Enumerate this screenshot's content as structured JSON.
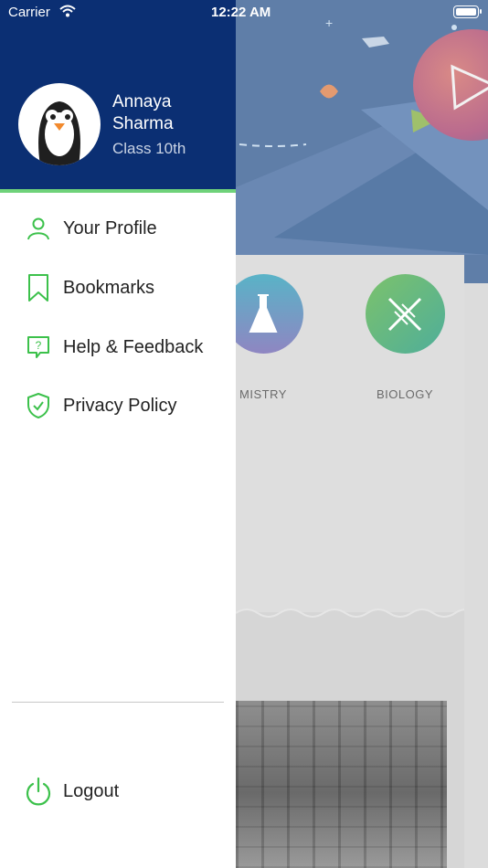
{
  "status_bar": {
    "carrier": "Carrier",
    "time": "12:22 AM"
  },
  "user": {
    "first_name": "Annaya",
    "last_name": "Sharma",
    "class": "Class 10th"
  },
  "menu": {
    "profile": "Your Profile",
    "bookmarks": "Bookmarks",
    "help": "Help & Feedback",
    "privacy": "Privacy Policy",
    "logout": "Logout"
  },
  "background": {
    "subjects": {
      "chemistry": "MISTRY",
      "biology": "BIOLOGY"
    }
  },
  "colors": {
    "header": "#0b2f73",
    "accent": "#6fd27a",
    "icon_green": "#3cc14b"
  }
}
